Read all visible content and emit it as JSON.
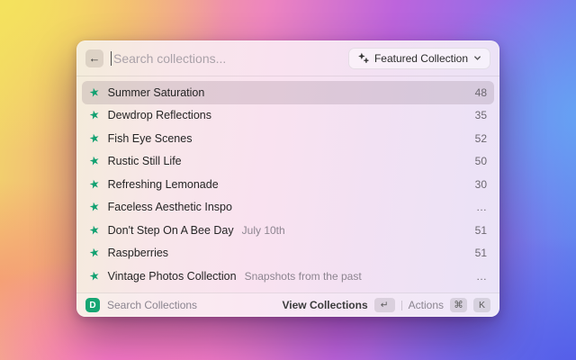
{
  "background": {
    "gradient_colors": [
      "#f4e35c",
      "#f3ab80",
      "#ee85bf",
      "#bd64dc",
      "#64aaf5",
      "#5458e8"
    ]
  },
  "colors": {
    "accent_green": "#17a673",
    "star_green": "#12a171",
    "selected_row": "rgba(100,80,92,0.17)"
  },
  "icons": {
    "back": "←",
    "star": "★",
    "chevron_down": "⌄",
    "return_key": "↵",
    "command_key": "⌘",
    "ellipsis": "…"
  },
  "window": {
    "search": {
      "placeholder": "Search collections..."
    },
    "filter_button": {
      "label": "Featured Collection"
    },
    "selected_index": 0,
    "list": [
      {
        "title": "Summer Saturation",
        "count": "48"
      },
      {
        "title": "Dewdrop Reflections",
        "count": "35"
      },
      {
        "title": "Fish Eye Scenes",
        "count": "52"
      },
      {
        "title": "Rustic Still Life",
        "count": "50"
      },
      {
        "title": "Refreshing Lemonade",
        "count": "30"
      },
      {
        "title": "Faceless Aesthetic Inspo",
        "count": "…"
      },
      {
        "title": "Don't Step On A Bee Day",
        "subtitle": "July 10th",
        "count": "51"
      },
      {
        "title": "Raspberries",
        "count": "51"
      },
      {
        "title": "Vintage Photos Collection",
        "subtitle": "Snapshots from the past",
        "count": "…"
      }
    ],
    "footer": {
      "logo_glyph": "D",
      "app_label": "Search Collections",
      "primary_action": "View Collections",
      "primary_key": "↵",
      "secondary_action": "Actions",
      "secondary_keys": [
        "⌘",
        "K"
      ]
    }
  }
}
